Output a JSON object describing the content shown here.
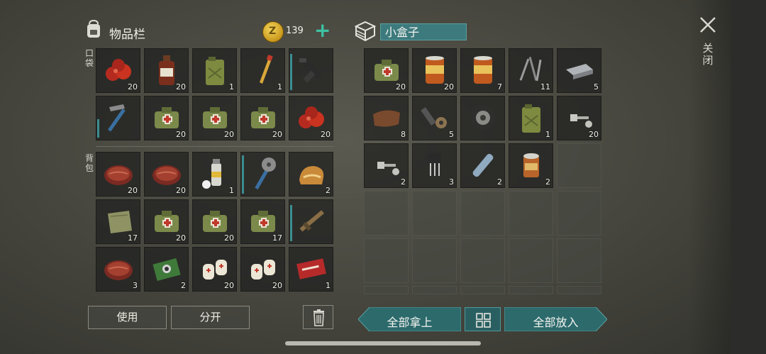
{
  "inventory": {
    "title": "物品栏",
    "coins": "139",
    "pocket_label": "口袋",
    "backpack_label": "背包",
    "pocket_items": [
      {
        "name": "apples",
        "qty": "20"
      },
      {
        "name": "bottle",
        "qty": "20"
      },
      {
        "name": "jerrycan",
        "qty": "1"
      },
      {
        "name": "water-bottle",
        "qty": "1"
      },
      {
        "name": "gun",
        "qty": "",
        "durability": 0.9
      },
      {
        "name": "hammer",
        "qty": "",
        "durability": 0.45
      },
      {
        "name": "medkit",
        "qty": "20"
      },
      {
        "name": "medkit",
        "qty": "20"
      },
      {
        "name": "medkit",
        "qty": "20"
      },
      {
        "name": "apples",
        "qty": "20"
      }
    ],
    "backpack_items": [
      {
        "name": "steak",
        "qty": "20"
      },
      {
        "name": "steak",
        "qty": "20"
      },
      {
        "name": "spray-can",
        "qty": "1"
      },
      {
        "name": "saw-club",
        "qty": "",
        "durability": 0.95
      },
      {
        "name": "bread",
        "qty": "2"
      },
      {
        "name": "cloth",
        "qty": "17"
      },
      {
        "name": "medkit",
        "qty": "20"
      },
      {
        "name": "medkit",
        "qty": "20"
      },
      {
        "name": "medkit",
        "qty": "17"
      },
      {
        "name": "rifle",
        "qty": "",
        "durability": 0.9
      },
      {
        "name": "steak",
        "qty": "3"
      },
      {
        "name": "circuit-board",
        "qty": "2"
      },
      {
        "name": "bandage",
        "qty": "20"
      },
      {
        "name": "bandage",
        "qty": "20"
      },
      {
        "name": "coupon",
        "qty": "1"
      }
    ],
    "use_label": "使用",
    "split_label": "分开"
  },
  "box": {
    "title": "小盒子",
    "items": [
      {
        "name": "medkit",
        "qty": "20"
      },
      {
        "name": "food-can",
        "qty": "20"
      },
      {
        "name": "food-can",
        "qty": "7"
      },
      {
        "name": "nails",
        "qty": "11"
      },
      {
        "name": "metal-bar",
        "qty": "5"
      },
      {
        "name": "leather",
        "qty": "8"
      },
      {
        "name": "parts",
        "qty": "5"
      },
      {
        "name": "tire",
        "qty": ""
      },
      {
        "name": "jerrycan",
        "qty": "1"
      },
      {
        "name": "bolt",
        "qty": "20"
      },
      {
        "name": "bolt",
        "qty": "2"
      },
      {
        "name": "transistor",
        "qty": "3"
      },
      {
        "name": "plastic-bottle",
        "qty": "2"
      },
      {
        "name": "open-can",
        "qty": "2"
      },
      {
        "name": "empty",
        "qty": ""
      }
    ],
    "take_all_label": "全部拿上",
    "put_all_label": "全部放入"
  },
  "close_label": "关闭",
  "colors": {
    "accent": "#3ec2a3",
    "teal_button": "#2c6a6c",
    "slot_bg": "#1e201e",
    "coin": "#d6a82a"
  }
}
